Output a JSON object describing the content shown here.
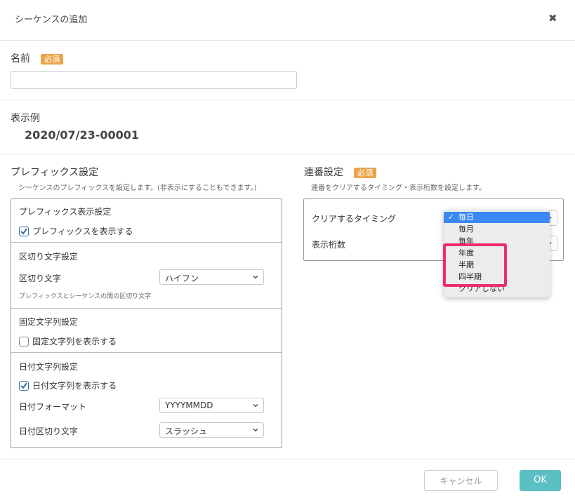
{
  "dialog": {
    "title": "シーケンスの追加",
    "close_icon": "close-icon"
  },
  "name_section": {
    "label": "名前",
    "required_badge": "必須",
    "value": ""
  },
  "example_section": {
    "label": "表示例",
    "value": "2020/07/23-00001"
  },
  "prefix_section": {
    "title": "プレフィックス設定",
    "description": "シーケンスのプレフィックスを設定します。(非表示にすることもできます。)",
    "display": {
      "title": "プレフィックス表示設定",
      "checkbox_label": "プレフィックスを表示する",
      "checked": true
    },
    "separator": {
      "title": "区切り文字設定",
      "field_label": "区切り文字",
      "selected": "ハイフン",
      "hint": "プレフィックスとシーケンスの間の区切り文字"
    },
    "fixed_string": {
      "title": "固定文字列設定",
      "checkbox_label": "固定文字列を表示する",
      "checked": false
    },
    "date_string": {
      "title": "日付文字列設定",
      "checkbox_label": "日付文字列を表示する",
      "checked": true,
      "format_label": "日付フォーマット",
      "format_selected": "YYYYMMDD",
      "sep_label": "日付区切り文字",
      "sep_selected": "スラッシュ"
    }
  },
  "serial_section": {
    "title": "連番設定",
    "required_badge": "必須",
    "description": "連番をクリアするタイミング・表示桁数を設定します。",
    "clear_timing_label": "クリアするタイミング",
    "digits_label": "表示桁数",
    "dropdown_options": [
      "毎日",
      "毎月",
      "毎年",
      "年度",
      "半期",
      "四半期",
      "クリアしない"
    ],
    "dropdown_selected": "毎日"
  },
  "footer": {
    "cancel_label": "キャンセル",
    "ok_label": "OK"
  },
  "colors": {
    "badge": "#eaa44c",
    "ok_button": "#5bbfc4",
    "dropdown_selected": "#3b88f5",
    "highlight": "#ef2d6a"
  }
}
